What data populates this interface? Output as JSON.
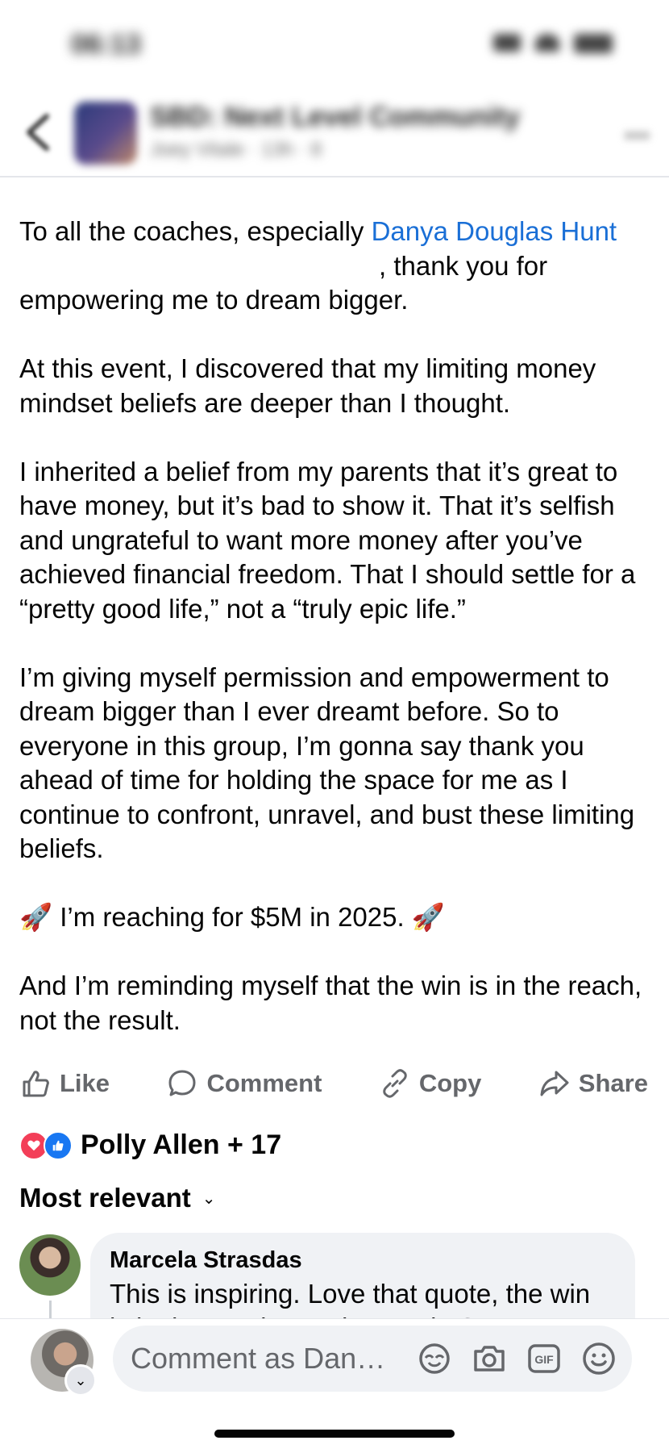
{
  "status_bar": {
    "time": "06:13"
  },
  "header": {
    "group_name": "SBD: Next Level Community",
    "subtitle": "Joey Vitale · 13h · 8"
  },
  "post": {
    "paragraph1_prefix": "To all the coaches, especially ",
    "mention": "Danya Douglas Hunt",
    "paragraph1_line2": ", thank you for",
    "paragraph1_line3": "empowering me to dream bigger.",
    "paragraph2": "At this event, I discovered that my limiting money mindset beliefs are deeper than I thought.",
    "paragraph3": "I inherited a belief from my parents that it’s great to have money, but it’s bad to show it. That it’s selfish and ungrateful to want more money after you’ve achieved financial freedom. That I should settle for a “pretty good life,” not a “truly epic life.”",
    "paragraph4": "I’m giving myself permission and empowerment to dream bigger than I ever dreamt before. So to everyone in this group, I’m gonna say thank you ahead of time for holding the space for me as I continue to confront, unravel, and bust these limiting beliefs.",
    "goal_emoji": "🚀",
    "goal_text": " I’m reaching for $5M in 2025. ",
    "paragraph6": "And I’m reminding myself that the win is in the reach, not the result."
  },
  "actions": {
    "like": "Like",
    "comment": "Comment",
    "copy": "Copy",
    "share": "Share"
  },
  "reactions": {
    "summary": "Polly Allen + 17"
  },
  "sort": {
    "label": "Most relevant",
    "chevron": "⌄"
  },
  "comment": {
    "author": "Marcela Strasdas",
    "text": "This is inspiring. Love that quote, the win is in the reach, not the result. So true"
  },
  "composer": {
    "placeholder": "Comment as Dany…",
    "chevron": "⌄"
  },
  "colors": {
    "mention": "#1a6fd6",
    "action_gray": "#65676b",
    "heart": "#f33e58",
    "like_blue": "#1877f2",
    "bubble": "#f0f2f5"
  }
}
